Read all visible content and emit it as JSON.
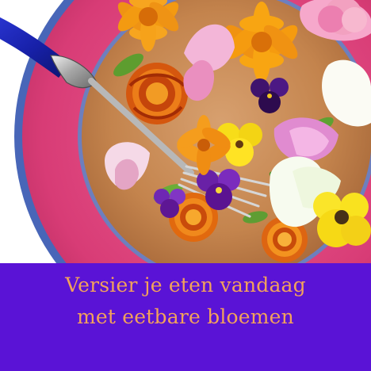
{
  "caption": {
    "line1": "Versier je eten vandaag",
    "line2": "met eetbare bloemen"
  },
  "colors": {
    "band": "#5a13d6",
    "caption_text": "#f3a25a",
    "plate_rim": "#d93b78",
    "plate_edge": "#4866b8",
    "plate_center": "#c98a57",
    "fork_handle": "#1c2bb6"
  },
  "photo": {
    "subject": "plate-with-edible-flowers",
    "objects": [
      "plate",
      "fork",
      "marigold",
      "calendula",
      "sweet-pea",
      "viola",
      "pansy"
    ]
  }
}
